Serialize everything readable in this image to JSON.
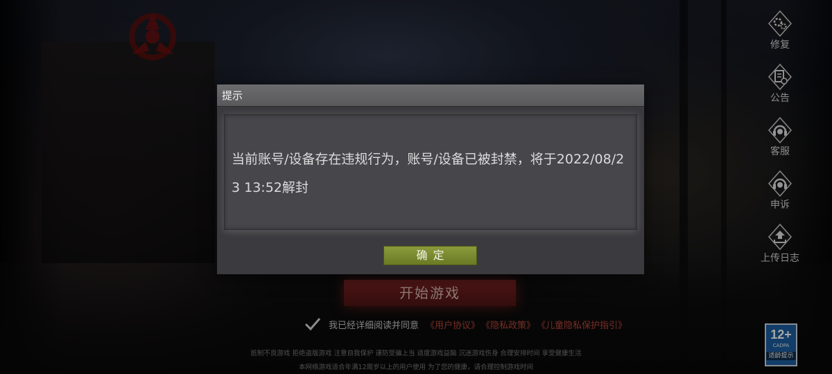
{
  "side_menu": [
    {
      "label": "修复",
      "icon": "gear-icon"
    },
    {
      "label": "公告",
      "icon": "notice-icon"
    },
    {
      "label": "客服",
      "icon": "headset-icon"
    },
    {
      "label": "申诉",
      "icon": "headset-icon"
    },
    {
      "label": "上传日志",
      "icon": "upload-icon"
    }
  ],
  "start_button": {
    "label": "开始游戏"
  },
  "agreement": {
    "text": "我已经详细阅读并同意",
    "links": [
      "《用户协议》",
      "《隐私政策》",
      "《儿童隐私保护指引》"
    ]
  },
  "footer": {
    "line1": "抵制不良游戏  拒绝盗版游戏  注意自我保护  谨防受骗上当  适度游戏益脑  沉迷游戏伤身  合理安排时间  享受健康生活",
    "line2": "本网络游戏适合年满12周岁以上的用户使用    为了您的健康，请合理控制游戏时间"
  },
  "age_rating": {
    "number": "12+",
    "org": "CADPA",
    "tip": "适龄提示"
  },
  "dialog": {
    "title": "提示",
    "message": "当前账号/设备存在违规行为，账号/设备已被封禁，将于2022/08/23 13:52解封",
    "confirm_label": "确定"
  },
  "colors": {
    "dialog_bg": "#3b3b3f",
    "confirm_button": "#7b8b30",
    "start_button": "#6b1f1d",
    "link": "#b8473a",
    "age_badge": "#1d5fa0"
  }
}
